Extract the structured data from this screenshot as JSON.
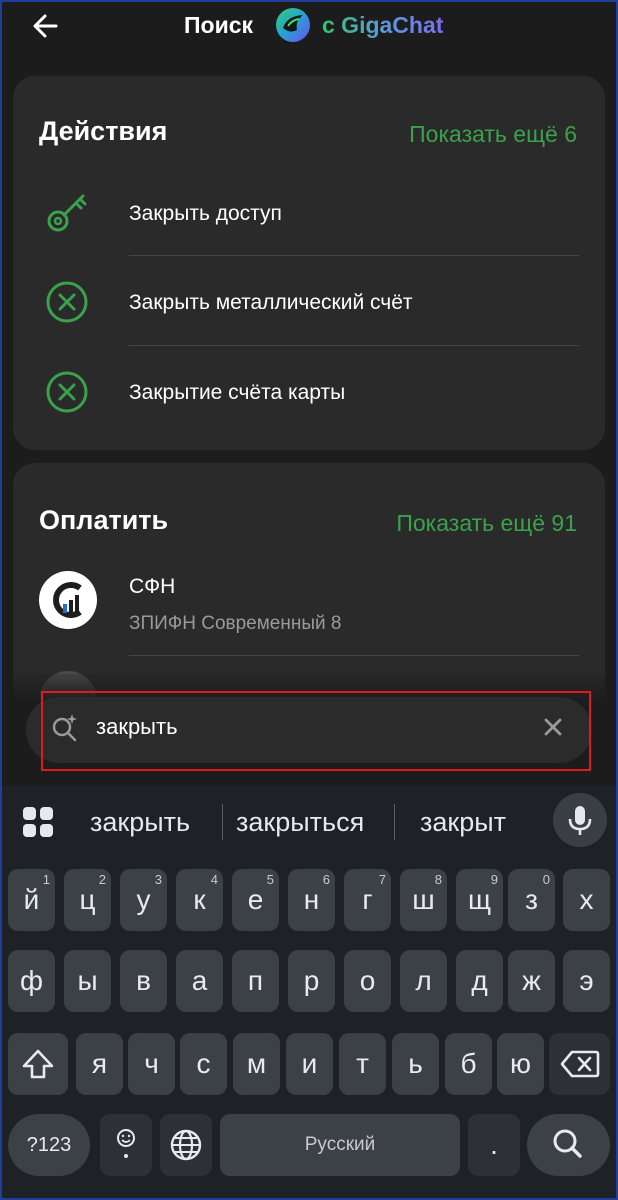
{
  "header": {
    "back_icon": "arrow-left-icon",
    "title": "Поиск",
    "brand_text": "с GigaChat",
    "brand_icon": "gigachat-logo-icon"
  },
  "actions": {
    "title": "Действия",
    "show_more": "Показать ещё 6",
    "items": [
      {
        "icon": "key-icon",
        "label": "Закрыть доступ"
      },
      {
        "icon": "circle-x-icon",
        "label": "Закрыть металлический счёт"
      },
      {
        "icon": "circle-x-icon",
        "label": "Закрытие счёта карты"
      }
    ]
  },
  "pay": {
    "title": "Оплатить",
    "show_more": "Показать ещё 91",
    "items": [
      {
        "icon": "sfn-logo-icon",
        "title": "СФН",
        "subtitle": "ЗПИФН Современный 8"
      }
    ]
  },
  "search": {
    "value": "закрыть",
    "icon": "ai-search-icon",
    "clear_icon": "close-icon"
  },
  "keyboard": {
    "suggestions": [
      "закрыть",
      "закрыться",
      "закрыт"
    ],
    "row1": [
      {
        "k": "й",
        "h": "1"
      },
      {
        "k": "ц",
        "h": "2"
      },
      {
        "k": "у",
        "h": "3"
      },
      {
        "k": "к",
        "h": "4"
      },
      {
        "k": "е",
        "h": "5"
      },
      {
        "k": "н",
        "h": "6"
      },
      {
        "k": "г",
        "h": "7"
      },
      {
        "k": "ш",
        "h": "8"
      },
      {
        "k": "щ",
        "h": "9"
      },
      {
        "k": "з",
        "h": "0"
      },
      {
        "k": "х",
        "h": ""
      }
    ],
    "row2": [
      "ф",
      "ы",
      "в",
      "а",
      "п",
      "р",
      "о",
      "л",
      "д",
      "ж",
      "э"
    ],
    "row3": [
      "я",
      "ч",
      "с",
      "м",
      "и",
      "т",
      "ь",
      "б",
      "ю"
    ],
    "num_label": "?123",
    "space_label": "Русский",
    "dot_label": "."
  },
  "colors": {
    "accent_green": "#3aa24a",
    "card_bg": "#2a2a2a",
    "page_bg": "#1c1c1c",
    "highlight_red": "#e0191f"
  }
}
